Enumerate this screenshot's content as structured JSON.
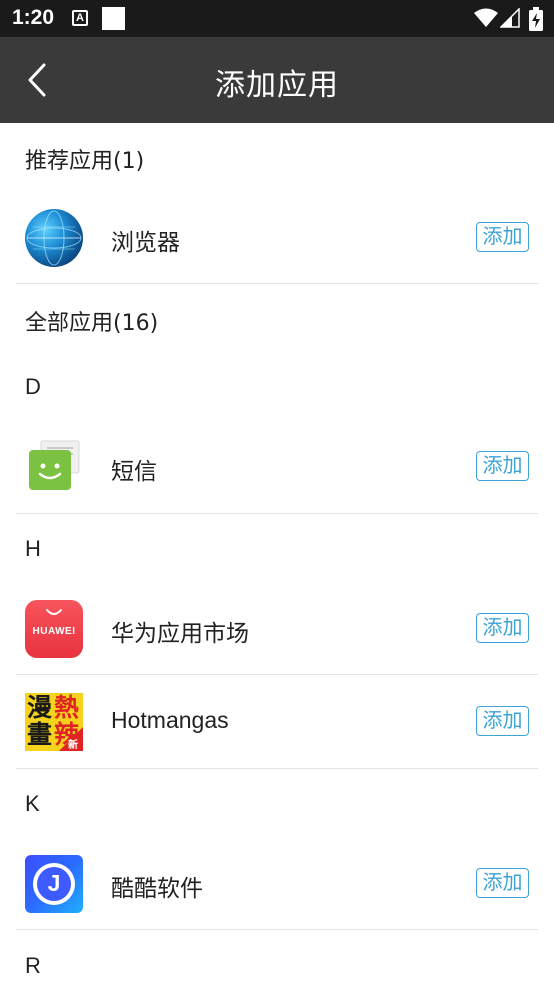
{
  "status_bar": {
    "time": "1:20",
    "notification_letter": "A"
  },
  "header": {
    "title": "添加应用"
  },
  "sections": {
    "recommended": "推荐应用(1)",
    "all": "全部应用(16)"
  },
  "letters": [
    "D",
    "H",
    "K",
    "R"
  ],
  "apps": [
    {
      "name": "浏览器",
      "add_label": "添加",
      "icon": "globe-icon"
    },
    {
      "name": "短信",
      "add_label": "添加",
      "icon": "message-icon"
    },
    {
      "name": "华为应用市场",
      "add_label": "添加",
      "icon": "huawei-appgallery-icon",
      "icon_text": "HUAWEI"
    },
    {
      "name": "Hotmangas",
      "add_label": "添加",
      "icon": "hotmangas-icon",
      "icon_text": [
        "漫",
        "熱",
        "畫",
        "辣"
      ],
      "icon_badge": "新"
    },
    {
      "name": "酷酷软件",
      "add_label": "添加",
      "icon": "kuku-icon",
      "icon_text": "J"
    }
  ],
  "colors": {
    "accent": "#3ba3d6",
    "app_bar": "#3a3a3a",
    "status_bar": "#1a1a1a"
  }
}
